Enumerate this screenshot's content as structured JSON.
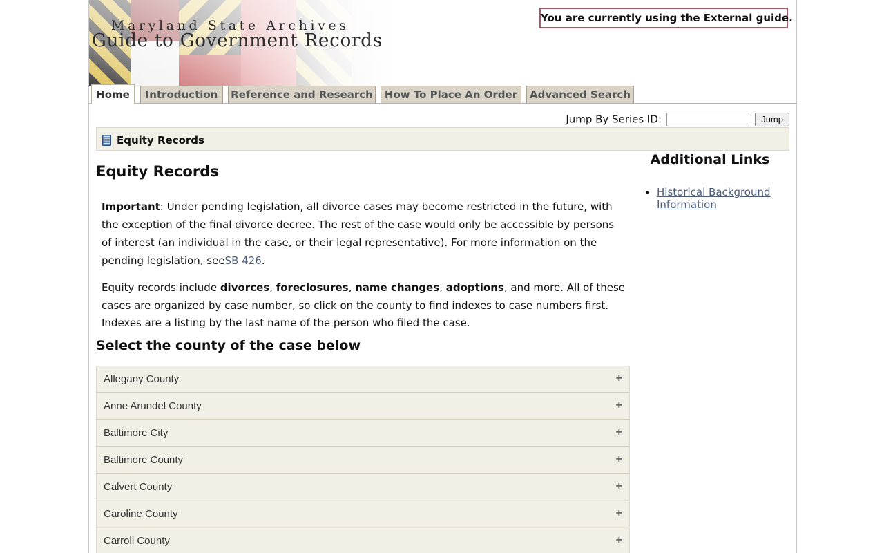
{
  "header": {
    "subtitle": "Maryland State Archives",
    "title": "Guide to Government Records",
    "guide_notice": "You are currently using the External guide."
  },
  "tabs": [
    {
      "label": "Home",
      "active": true
    },
    {
      "label": "Introduction",
      "active": false
    },
    {
      "label": "Reference and Research",
      "active": false
    },
    {
      "label": "How To Place An Order",
      "active": false
    },
    {
      "label": "Advanced Search",
      "active": false
    }
  ],
  "jump": {
    "label": "Jump By Series ID:",
    "input_value": "",
    "button_label": "Jump"
  },
  "breadcrumb": {
    "icon": "book-icon",
    "label": "Equity Records"
  },
  "main": {
    "title": "Equity Records",
    "important_label": "Important",
    "important_text": ": Under pending legislation, all divorce cases may become restricted in the future, with the exception of the final divorce decree. The rest of the case would only be accessible by persons of interest (an individual in the case, or their legal representative). For more information on the pending legislation, see",
    "important_link": "SB 426",
    "important_end": ".",
    "equity_intro": "Equity records include ",
    "equity_term_1": "divorces",
    "equity_sep_1": ", ",
    "equity_term_2": "foreclosures",
    "equity_sep_2": ", ",
    "equity_term_3": "name changes",
    "equity_sep_3": ", ",
    "equity_term_4": "adoptions",
    "equity_rest": ", and more. All of these cases are organized by case number, so click on the county to find indexes to case numbers first. Indexes are a listing by the last name of the person who filed the case.",
    "county_heading": "Select the county of the case below",
    "counties": [
      {
        "name": "Allegany County",
        "toggle": "+"
      },
      {
        "name": "Anne Arundel County",
        "toggle": "+"
      },
      {
        "name": "Baltimore City",
        "toggle": "+"
      },
      {
        "name": "Baltimore County",
        "toggle": "+"
      },
      {
        "name": "Calvert County",
        "toggle": "+"
      },
      {
        "name": "Caroline County",
        "toggle": "+"
      },
      {
        "name": "Carroll County",
        "toggle": "+"
      }
    ]
  },
  "sidebar": {
    "title": "Additional Links",
    "links": [
      {
        "label": "Historical Background Information"
      }
    ]
  },
  "colors": {
    "accent_border": "#a85a66",
    "panel_bg": "#f2efe6",
    "tab_bg": "#d9d4c7",
    "link": "#4a5b7c"
  }
}
